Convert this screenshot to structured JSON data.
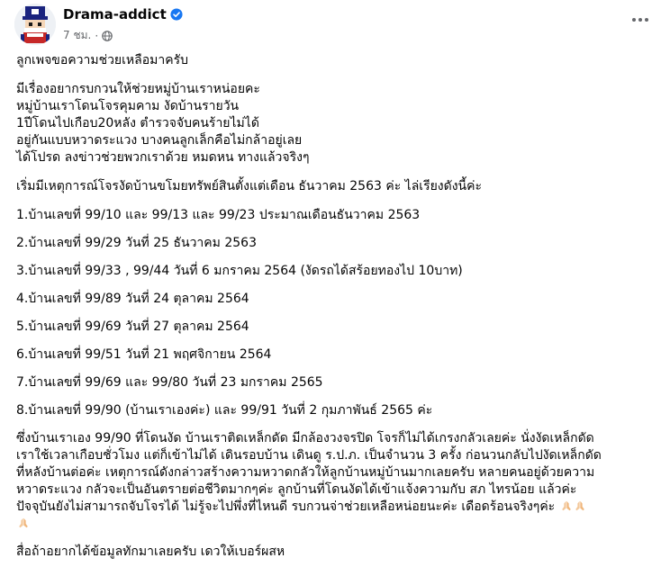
{
  "post": {
    "author": "Drama-addict",
    "timestamp": "7 ชม.",
    "colors": {
      "verified": "#1877f2",
      "meta": "#65676b",
      "text": "#050505"
    },
    "icons": {
      "verified": "verified-badge-icon",
      "audience": "globe-icon",
      "more": "more-options-icon",
      "emoji": "folded-hands-emoji"
    },
    "paragraphs": {
      "p1": "ลูกเพจขอความช่วยเหลือมาครับ",
      "p2": [
        "มีเรื่องอยากรบกวนให้ช่วยหมู่บ้านเราหน่อยคะ",
        "หมู่บ้านเราโดนโจรคุมคาม งัดบ้านรายวัน",
        "1ปีโดนไปเกือบ20หลัง ตำรวจจับคนร้ายไม่ได้",
        "อยู่กันแบบหวาดระแวง บางคนลูกเล็กคือไม่กล้าอยู่เลย",
        "ได้โปรด ลงข่าวช่วยพวกเราด้วย หมดหน ทางแล้วจริงๆ"
      ],
      "p3": "เริ่มมีเหตุการณ์โจรงัดบ้านขโมยทรัพย์สินตั้งแต่เดือน ธันวาคม 2563 ค่ะ ไล่เรียงดังนี้ค่ะ",
      "incidents": [
        "1.บ้านเลขที่ 99/10 และ 99/13 และ 99/23 ประมาณเดือนธันวาคม 2563",
        "2.บ้านเลขที่ 99/29 วันที่ 25 ธันวาคม 2563",
        "3.บ้านเลขที่ 99/33 , 99/44 วันที่ 6 มกราคม 2564 (งัดรถได้สร้อยทองไป 10บาท)",
        "4.บ้านเลขที่ 99/89 วันที่ 24 ตุลาคม 2564",
        "5.บ้านเลขที่ 99/69 วันที่ 27 ตุลาคม 2564",
        "6.บ้านเลขที่ 99/51 วันที่ 21 พฤศจิกายน 2564",
        "7.บ้านเลขที่ 99/69 และ 99/80 วันที่ 23 มกราคม 2565",
        "8.บ้านเลขที่ 99/90 (บ้านเราเองค่ะ) และ 99/91 วันที่ 2 กุมภาพันธ์ 2565 ค่ะ"
      ],
      "p5": [
        "ซึ่งบ้านเราเอง 99/90 ที่โดนงัด บ้านเราติดเหล็กดัด มีกล้องวงจรปิด โจรก็ไม่ได้เกรงกลัวเลยค่ะ นั่งงัดเหล็กดัด",
        "เราใช้เวลาเกือบชั่วโมง แต่ก็เข้าไม่ได้ เดินรอบบ้าน เดินดู ร.ป.ภ. เป็นจำนวน 3 ครั้ง ก่อนวนกลับไปงัดเหล็กดัด",
        "ที่หลังบ้านต่อค่ะ เหตุการณ์ดังกล่าวสร้างความหวาดกลัวให้ลูกบ้านหมู่บ้านมากเลยครับ หลายคนอยู่ด้วยความ",
        "หวาดระแวง กลัวจะเป็นอันตรายต่อชีวิตมากๆค่ะ ลูกบ้านที่โดนงัดได้เข้าแจ้งความกับ สภ ไทรน้อย แล้วค่ะ",
        "ปัจจุบันยังไม่สามารถจับโจรได้ ไม่รู้จะไปพึ่งที่ไหนดี รบกวนจ่าช่วยเหลือหน่อยนะค่ะ เดือดร้อนจริงๆค่ะ"
      ],
      "p6": "สื่อถ้าอยากได้ข้อมูลทักมาเลยครับ เดวให้เบอร์ผสห"
    }
  }
}
